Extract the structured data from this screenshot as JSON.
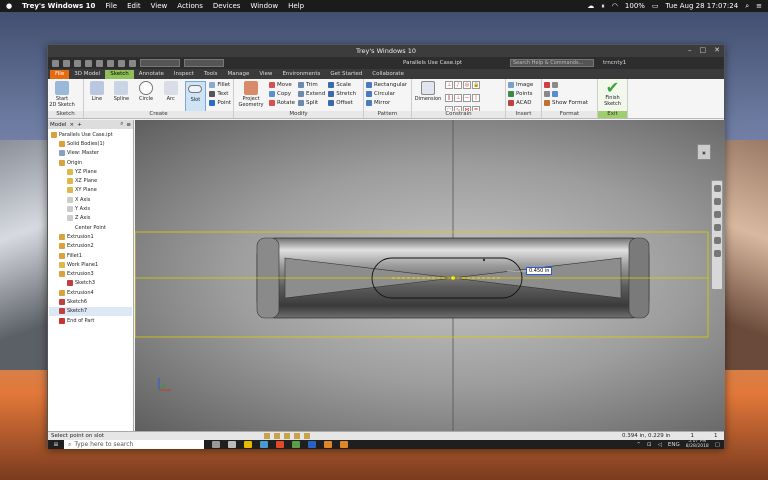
{
  "menubar": {
    "apple": "",
    "app": "Trey's Windows 10",
    "items": [
      "File",
      "Edit",
      "View",
      "Actions",
      "Devices",
      "Window",
      "Help"
    ],
    "battery": "100%",
    "clock": "Tue Aug 28  17:07:24"
  },
  "window": {
    "title": "Trey's Windows 10",
    "doc_name": "Parallels Use Case.ipt",
    "search_placeholder": "Search Help & Commands...",
    "user": "trncnty1"
  },
  "tabs": [
    "File",
    "3D Model",
    "Sketch",
    "Annotate",
    "Inspect",
    "Tools",
    "Manage",
    "View",
    "Environments",
    "Get Started",
    "Collaborate"
  ],
  "ribbon": {
    "sketch_group": {
      "label": "Sketch",
      "start": "Start\n2D Sketch"
    },
    "create_group": {
      "label": "Create",
      "line": "Line",
      "spline": "Spline",
      "circle": "Circle",
      "arc": "Arc",
      "slot": "Slot",
      "fillet": "Fillet",
      "text": "Text",
      "point": "Point"
    },
    "modify_group": {
      "label": "Modify",
      "project": "Project\nGeometry",
      "move": "Move",
      "trim": "Trim",
      "scale": "Scale",
      "copy": "Copy",
      "extend": "Extend",
      "stretch": "Stretch",
      "rotate": "Rotate",
      "split": "Split",
      "offset": "Offset"
    },
    "pattern_group": {
      "label": "Pattern",
      "rectangular": "Rectangular",
      "circular": "Circular",
      "mirror": "Mirror"
    },
    "constrain_group": {
      "label": "Constrain",
      "dimension": "Dimension"
    },
    "insert_group": {
      "label": "Insert",
      "image": "Image",
      "points": "Points",
      "acad": "ACAD"
    },
    "format_group": {
      "label": "Format",
      "show_format": "Show Format"
    },
    "exit_group": {
      "label": "Exit",
      "finish": "Finish\nSketch"
    }
  },
  "browser": {
    "tab": "Model",
    "items": [
      {
        "label": "Parallels Use Case.ipt",
        "indent": 0,
        "color": "#d9a23a"
      },
      {
        "label": "Solid Bodies(1)",
        "indent": 1,
        "color": "#d9a23a"
      },
      {
        "label": "View: Master",
        "indent": 1,
        "color": "#8aa0c0"
      },
      {
        "label": "Origin",
        "indent": 1,
        "color": "#d9a23a"
      },
      {
        "label": "YZ Plane",
        "indent": 2,
        "color": "#e0b84a"
      },
      {
        "label": "XZ Plane",
        "indent": 2,
        "color": "#e0b84a"
      },
      {
        "label": "XY Plane",
        "indent": 2,
        "color": "#e0b84a"
      },
      {
        "label": "X Axis",
        "indent": 2,
        "color": "#cccccc"
      },
      {
        "label": "Y Axis",
        "indent": 2,
        "color": "#cccccc"
      },
      {
        "label": "Z Axis",
        "indent": 2,
        "color": "#cccccc"
      },
      {
        "label": "Center Point",
        "indent": 2,
        "color": "#ffffff"
      },
      {
        "label": "Extrusion1",
        "indent": 1,
        "color": "#d9a23a"
      },
      {
        "label": "Extrusion2",
        "indent": 1,
        "color": "#d9a23a"
      },
      {
        "label": "Fillet1",
        "indent": 1,
        "color": "#d9a23a"
      },
      {
        "label": "Work Plane1",
        "indent": 1,
        "color": "#e0b84a"
      },
      {
        "label": "Extrusion3",
        "indent": 1,
        "color": "#d9a23a"
      },
      {
        "label": "Sketch3",
        "indent": 2,
        "color": "#c04040"
      },
      {
        "label": "Extrusion4",
        "indent": 1,
        "color": "#d9a23a"
      },
      {
        "label": "Sketch6",
        "indent": 1,
        "color": "#c04040"
      },
      {
        "label": "Sketch7",
        "indent": 1,
        "color": "#c04040",
        "selected": true
      },
      {
        "label": "End of Part",
        "indent": 1,
        "color": "#cc3030"
      }
    ]
  },
  "viewport": {
    "dimension": "0.450 in"
  },
  "status": {
    "prompt": "Select point on slot",
    "coords": "0.394 in, 0.229 in",
    "num1": "1",
    "num2": "1"
  },
  "taskbar": {
    "search_placeholder": "Type here to search",
    "lang": "ENG",
    "time": "5:07 PM",
    "date": "8/28/2018"
  }
}
